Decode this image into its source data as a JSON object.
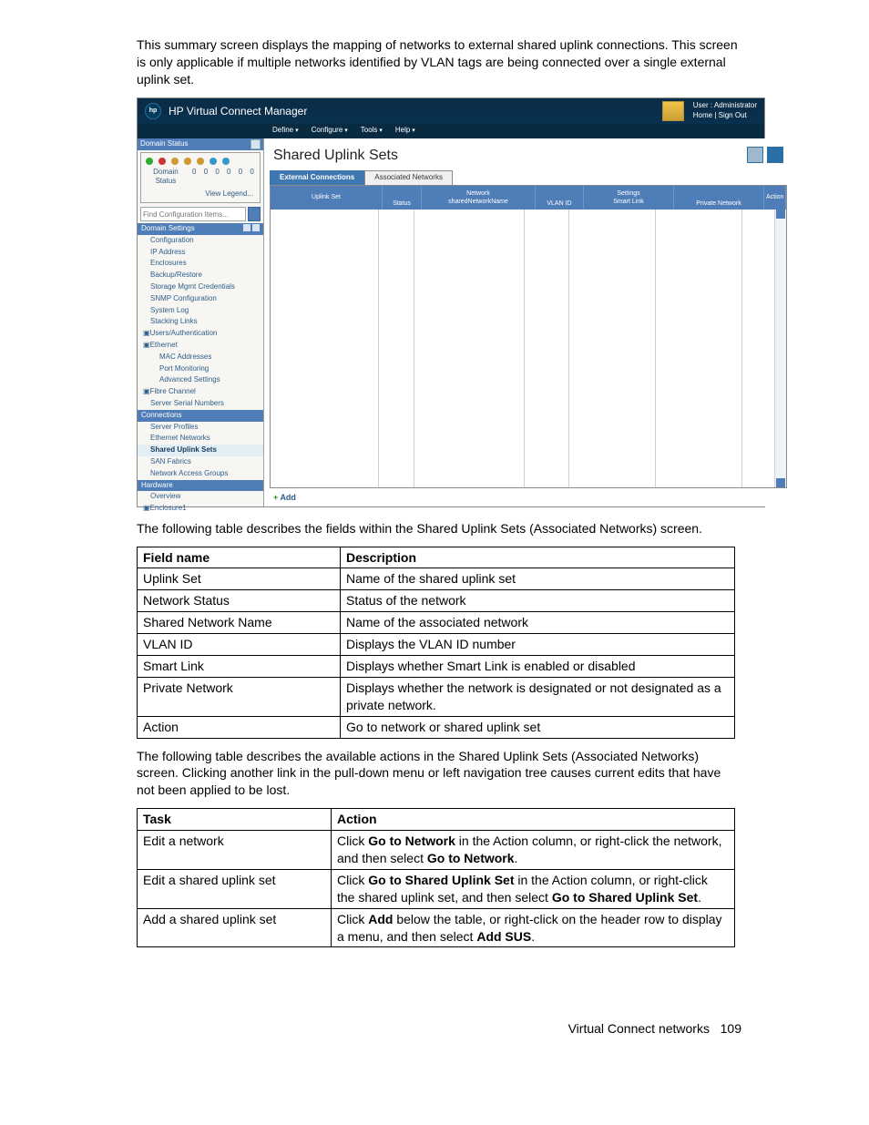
{
  "intro": "This summary screen displays the mapping of networks to external shared uplink connections. This screen is only applicable if multiple networks identified by VLAN tags are being connected over a single external uplink set.",
  "app": {
    "title": "HP Virtual Connect Manager",
    "user_line": "User : Administrator",
    "links": "Home  |  Sign Out",
    "menus": [
      "Define",
      "Configure",
      "Tools",
      "Help"
    ]
  },
  "sidebar": {
    "domain_status": "Domain Status",
    "domain_label": "Domain Status",
    "view_legend": "View Legend...",
    "search_placeholder": "Find Configuration Items...",
    "domain_settings": "Domain Settings",
    "settings_items": [
      "Configuration",
      "IP Address",
      "Enclosures",
      "Backup/Restore",
      "Storage Mgmt Credentials",
      "SNMP Configuration",
      "System Log",
      "Stacking Links"
    ],
    "users_auth": "Users/Authentication",
    "ethernet": "Ethernet",
    "eth_items": [
      "MAC Addresses",
      "Port Monitoring",
      "Advanced Settings"
    ],
    "fibre": "Fibre Channel",
    "serials": "Server Serial Numbers",
    "connections": "Connections",
    "conn_items": [
      "Server Profiles",
      "Ethernet Networks",
      "Shared Uplink Sets",
      "SAN Fabrics",
      "Network Access Groups"
    ],
    "hardware": "Hardware",
    "hw_items": [
      "Overview",
      "Enclosure1"
    ]
  },
  "page": {
    "title": "Shared Uplink Sets",
    "tabs": [
      "External Connections",
      "Associated Networks"
    ],
    "cols_top": {
      "network": "Network",
      "settings": "Settings"
    },
    "cols": [
      "Uplink Set",
      "Status",
      "sharedNetworkName",
      "VLAN ID",
      "Smart Link",
      "Private Network",
      "Action"
    ],
    "add": "Add"
  },
  "table_intro": "The following table describes the fields within the Shared Uplink Sets (Associated Networks) screen.",
  "table1": {
    "head": [
      "Field name",
      "Description"
    ],
    "rows": [
      [
        "Uplink Set",
        "Name of the shared uplink set"
      ],
      [
        "Network Status",
        "Status of the network"
      ],
      [
        "Shared Network Name",
        "Name of the associated network"
      ],
      [
        "VLAN ID",
        "Displays the VLAN ID number"
      ],
      [
        "Smart Link",
        "Displays whether Smart Link is enabled or disabled"
      ],
      [
        "Private Network",
        "Displays whether the network is designated or not designated as a private network."
      ],
      [
        "Action",
        "Go to network or shared uplink set"
      ]
    ]
  },
  "actions_intro": "The following table describes the available actions in the Shared Uplink Sets (Associated Networks) screen. Clicking another link in the pull-down menu or left navigation tree causes current edits that have not been applied to be lost.",
  "table2": {
    "head": [
      "Task",
      "Action"
    ],
    "rows": [
      {
        "task": "Edit a network",
        "pre": "Click ",
        "b1": "Go to Network",
        "mid": " in the Action column, or right-click the network, and then select ",
        "b2": "Go to Network",
        "post": "."
      },
      {
        "task": "Edit a shared uplink set",
        "pre": "Click ",
        "b1": "Go to Shared Uplink Set",
        "mid": " in the Action column, or right-click the shared uplink set, and then select ",
        "b2": "Go to Shared Uplink Set",
        "post": "."
      },
      {
        "task": "Add a shared uplink set",
        "pre": "Click ",
        "b1": "Add",
        "mid": " below the table, or right-click on the header row to display a menu, and then select ",
        "b2": "Add SUS",
        "post": "."
      }
    ]
  },
  "footer": {
    "section": "Virtual Connect networks",
    "page": "109"
  }
}
